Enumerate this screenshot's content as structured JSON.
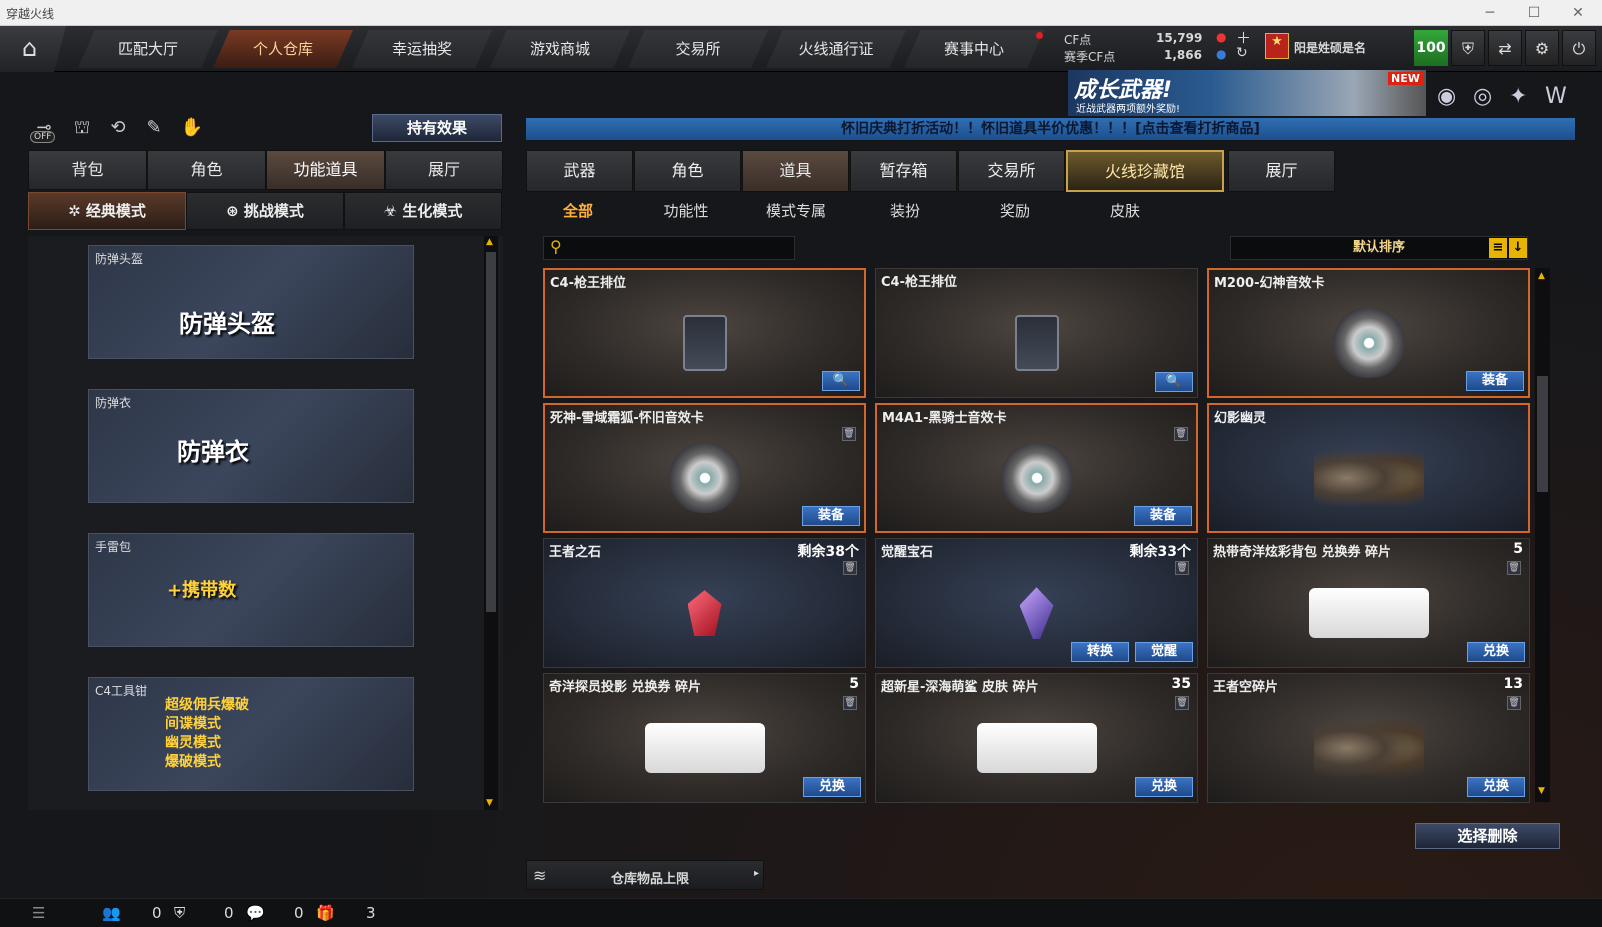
{
  "window": {
    "title": "穿越火线"
  },
  "nav": {
    "tabs": [
      "匹配大厅",
      "个人仓库",
      "幸运抽奖",
      "游戏商城",
      "交易所",
      "火线通行证",
      "赛事中心"
    ]
  },
  "currency": {
    "cf_label": "CF点",
    "cf_value": "15,799",
    "season_label": "赛季CF点",
    "season_value": "1,866"
  },
  "user": {
    "name": "阳是姓硕是名",
    "level": "100"
  },
  "banner": {
    "text": "成长武器!",
    "sub": "近战武器两项额外奖励!",
    "badge": "NEW"
  },
  "notice": "怀旧庆典打折活动！！怀旧道具半价优惠！！！[点击查看打折商品]",
  "left": {
    "off_label": "OFF",
    "hold_button": "持有效果",
    "tabs": [
      "背包",
      "角色",
      "功能道具",
      "展厅"
    ],
    "modes": [
      "经典模式",
      "挑战模式",
      "生化模式"
    ],
    "cards": [
      {
        "label": "防弹头盔",
        "big": "防弹头盔"
      },
      {
        "label": "防弹衣",
        "big": "防弹衣"
      },
      {
        "label": "手雷包",
        "big": "+携带数"
      },
      {
        "label": "C4工具钳",
        "lines": [
          "超级佣兵爆破",
          "间谍模式",
          "幽灵模式",
          "爆破模式"
        ]
      }
    ]
  },
  "right": {
    "tabs": [
      "武器",
      "角色",
      "道具",
      "暂存箱",
      "交易所",
      "火线珍藏馆",
      "展厅"
    ],
    "subtabs": [
      "全部",
      "功能性",
      "模式专属",
      "装扮",
      "奖励",
      "皮肤"
    ],
    "sort": "默认排序",
    "items": [
      {
        "name": "C4-枪王排位",
        "count": "",
        "button": "🔍",
        "art": "device"
      },
      {
        "name": "C4-枪王排位",
        "count": "",
        "button": "🔍",
        "art": "device"
      },
      {
        "name": "M200-幻神音效卡",
        "count": "",
        "button": "装备",
        "art": "disc"
      },
      {
        "name": "死神-雪域霜狐-怀旧音效卡",
        "count": "",
        "button": "装备",
        "art": "disc"
      },
      {
        "name": "M4A1-黑骑士音效卡",
        "count": "",
        "button": "装备",
        "art": "disc"
      },
      {
        "name": "幻影幽灵",
        "count": "",
        "button": "",
        "art": "people"
      },
      {
        "name": "王者之石",
        "count": "剩余38个",
        "button": "",
        "art": "gem"
      },
      {
        "name": "觉醒宝石",
        "count": "剩余33个",
        "button": "觉醒",
        "button2": "转换",
        "art": "gem2"
      },
      {
        "name": "热带奇洋炫彩背包 兑换券 碎片",
        "count": "5",
        "button": "兑换",
        "art": "ticket"
      },
      {
        "name": "奇洋探员投影 兑换券 碎片",
        "count": "5",
        "button": "兑换",
        "art": "ticket"
      },
      {
        "name": "超新星-深海萌鲨 皮肤 碎片",
        "count": "35",
        "button": "兑换",
        "art": "ticket"
      },
      {
        "name": "王者空碎片",
        "count": "13",
        "button": "兑换",
        "art": "people"
      }
    ],
    "delete_button": "选择删除",
    "capacity": "仓库物品上限"
  },
  "bottom": {
    "counts": [
      "0",
      "0",
      "0",
      "3"
    ]
  },
  "colors": {
    "accent": "#d2672d",
    "button_blue": "#3b73c4",
    "gold": "#c8a24a"
  }
}
